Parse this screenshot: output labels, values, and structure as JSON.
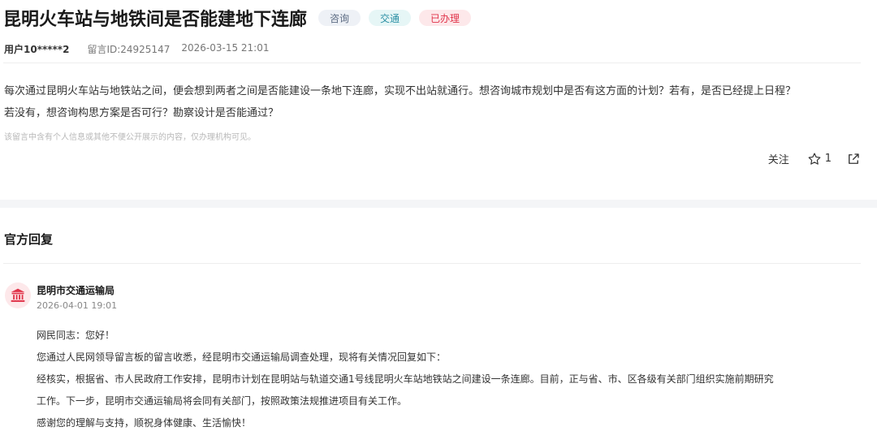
{
  "message": {
    "title": "昆明火车站与地铁间是否能建地下连廊",
    "tags": [
      "咨询",
      "交通",
      "已办理"
    ],
    "user": "用户10*****2",
    "message_id": "留言ID:24925147",
    "time": "2026-03-15 21:01",
    "body_lines": [
      "每次通过昆明火车站与地铁站之间，便会想到两者之间是否能建设一条地下连廊，实现不出站就通行。想咨询城市规划中是否有这方面的计划？若有，是否已经提上日程？",
      "若没有，想咨询构思方案是否可行？勘察设计是否能通过？"
    ],
    "privacy_notice": "该留言中含有个人信息或其他不便公开展示的内容，仅办理机构可见。",
    "follow_label": "关注",
    "like_count": "1",
    "icons": {
      "like": "star-icon",
      "share": "share-icon",
      "org": "government-building-icon"
    }
  },
  "official_reply": {
    "section_title": "官方回复",
    "org_name": "昆明市交通运输局",
    "reply_time": "2026-04-01 19:01",
    "lines": [
      "网民同志：您好！",
      "您通过人民网领导留言板的留言收悉，经昆明市交通运输局调查处理，现将有关情况回复如下：",
      "经核实，根据省、市人民政府工作安排，昆明市计划在昆明站与轨道交通1号线昆明火车站地铁站之间建设一条连廊。目前，正与省、市、区各级有关部门组织实施前期研究",
      "工作。下一步，昆明市交通运输局将会同有关部门，按照政策法规推进项目有关工作。",
      "感谢您的理解与支持，顺祝身体健康、生活愉快！"
    ]
  },
  "colors": {
    "tag_consult_bg": "#eef1f6",
    "tag_traffic_bg": "#e6f6f6",
    "tag_done_bg": "#fde8ea",
    "tag_done_text": "#e0334a",
    "band": "#f4f5f7"
  }
}
